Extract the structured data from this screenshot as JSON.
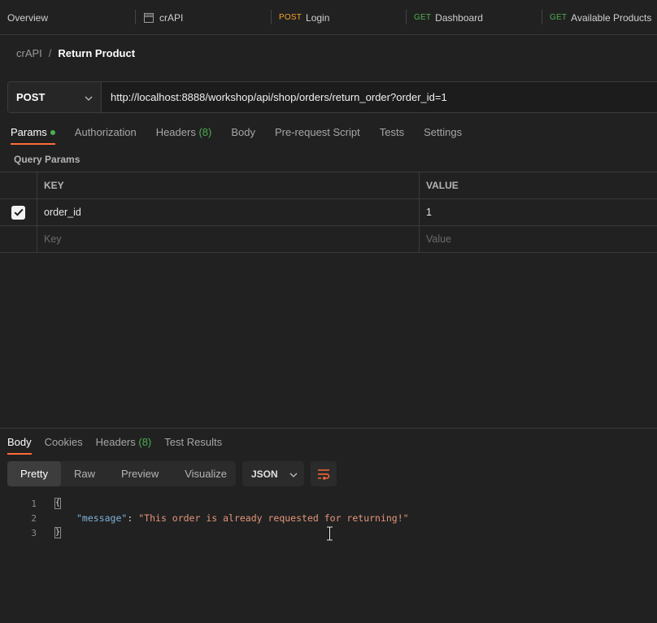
{
  "tabs": [
    {
      "label": "Overview",
      "method": "",
      "icon": ""
    },
    {
      "label": "crAPI",
      "method": "",
      "icon": "collection-icon"
    },
    {
      "label": "Login",
      "method": "POST",
      "icon": ""
    },
    {
      "label": "Dashboard",
      "method": "GET",
      "icon": ""
    },
    {
      "label": "Available Products",
      "method": "GET",
      "icon": ""
    }
  ],
  "breadcrumb": {
    "parent": "crAPI",
    "separator": "/",
    "current": "Return Product"
  },
  "request": {
    "method": "POST",
    "url": "http://localhost:8888/workshop/api/shop/orders/return_order?order_id=1"
  },
  "request_tabs": {
    "params": "Params",
    "authorization": "Authorization",
    "headers": "Headers",
    "headers_count": "(8)",
    "body": "Body",
    "prerequest": "Pre-request Script",
    "tests": "Tests",
    "settings": "Settings"
  },
  "query_params": {
    "title": "Query Params",
    "key_header": "KEY",
    "value_header": "VALUE",
    "rows": [
      {
        "key": "order_id",
        "value": "1",
        "checked": true
      }
    ],
    "key_placeholder": "Key",
    "value_placeholder": "Value"
  },
  "response_tabs": {
    "body": "Body",
    "cookies": "Cookies",
    "headers": "Headers",
    "headers_count": "(8)",
    "test_results": "Test Results"
  },
  "response_view": {
    "pretty": "Pretty",
    "raw": "Raw",
    "preview": "Preview",
    "visualize": "Visualize",
    "format": "JSON"
  },
  "response_body": {
    "line_numbers": [
      "1",
      "2",
      "3"
    ],
    "open_brace": "{",
    "close_brace": "}",
    "key": "\"message\"",
    "colon": ":",
    "value": "\"This order is already requested for returning!\""
  },
  "colors": {
    "accent": "#ff6c37",
    "post": "#f5a623",
    "get": "#4caf50",
    "background": "#212121"
  }
}
